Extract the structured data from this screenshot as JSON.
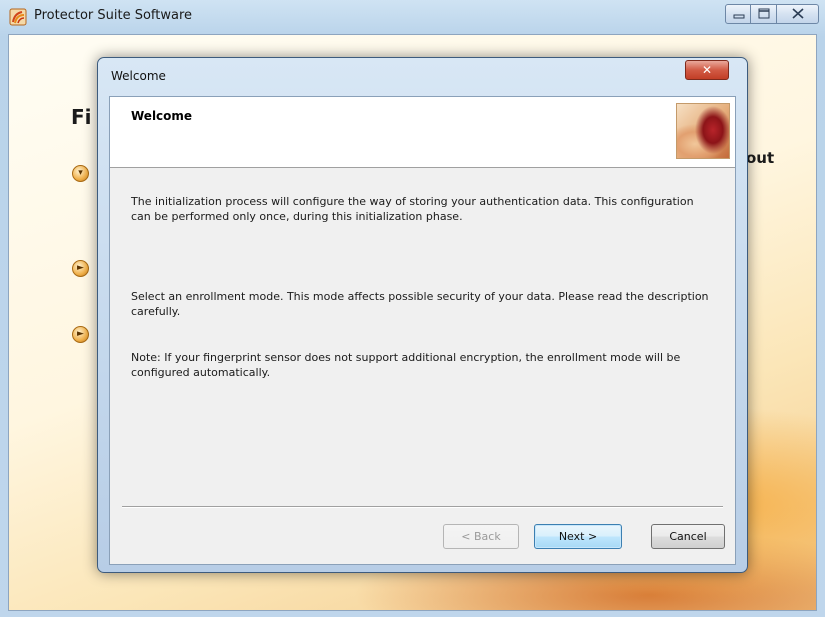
{
  "app": {
    "title": "Protector Suite Software",
    "logo_icon": "protector-suite-logo-icon",
    "caption_buttons": {
      "minimize_icon": "minimize-icon",
      "maximize_icon": "maximize-icon",
      "close_icon": "close-icon"
    }
  },
  "background": {
    "heading_partial": "Fi",
    "text_partial": "out",
    "bullet_icons": [
      "chevron-down-icon",
      "play-icon",
      "play-icon"
    ]
  },
  "dialog": {
    "title": "Welcome",
    "close_glyph": "✕",
    "header": {
      "title": "Welcome",
      "image_icon": "fingerprint-hand-icon"
    },
    "paragraphs": [
      "The initialization process will configure the way of storing your authentication data. This configuration can be performed only once, during this initialization phase.",
      "Select an enrollment mode. This mode affects possible security of your data. Please read the description carefully.",
      "Note: If your fingerprint sensor does not support additional encryption, the enrollment mode will be configured automatically."
    ],
    "buttons": {
      "back": "< Back",
      "next": "Next >",
      "cancel": "Cancel"
    }
  },
  "colors": {
    "dialog_accent": "#3c7fb1",
    "close_red": "#c23e26",
    "background_orange": "#f3c785"
  }
}
